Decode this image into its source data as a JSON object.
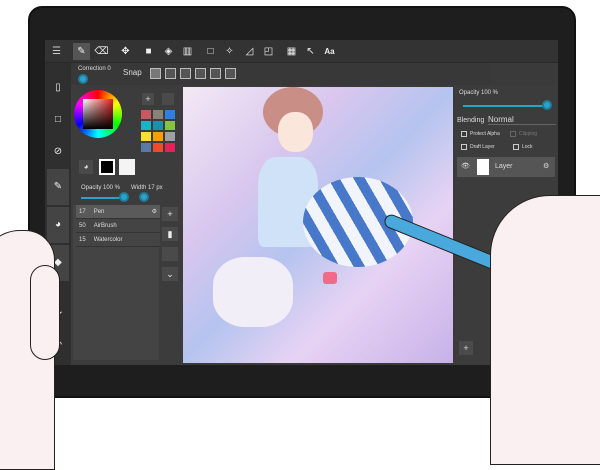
{
  "toolbar": {
    "tools": [
      "brush",
      "eraser",
      "move",
      "fill-rect",
      "bucket",
      "gradient",
      "select-rect",
      "magic-wand",
      "select-pen",
      "select-eraser",
      "frame",
      "pointer",
      "text"
    ],
    "text_label": "Aa",
    "active": "brush"
  },
  "correction": {
    "label": "Correction 0"
  },
  "snap": {
    "label": "Snap"
  },
  "leftcol": [
    "menu",
    "file",
    "selection",
    "rotate",
    "brush-panel",
    "color-panel",
    "layer-panel",
    "redo",
    "undo"
  ],
  "colors": {
    "swatches": [
      "#c8595e",
      "#8a8278",
      "#2f7fe0",
      "#1bb3c9",
      "#1d8fae",
      "#84c240",
      "#f2e12e",
      "#f5a000",
      "#a0a0a0",
      "#5a7aa5",
      "#ef4a2a",
      "#e8205a"
    ],
    "foreground": "#000000",
    "accent": "#2aa3c8"
  },
  "brush_settings": {
    "opacity": "Opacity 100 %",
    "width": "Width 17 px",
    "opacity_value": 100,
    "width_value": 17
  },
  "brushes": [
    {
      "size": "17",
      "name": "Pen",
      "selected": true
    },
    {
      "size": "50",
      "name": "AirBrush"
    },
    {
      "size": "15",
      "name": "Watercolor"
    }
  ],
  "layers_panel": {
    "opacity": "Opacity 100 %",
    "opacity_value": 100,
    "blending_label": "Blending",
    "blending": "Normal",
    "protect_alpha": "Protect Alpha",
    "clipping": "Clipping",
    "draft_layer": "Draft Layer",
    "lock": "Lock",
    "layers": [
      {
        "name": "Layer",
        "visible": true
      }
    ]
  }
}
